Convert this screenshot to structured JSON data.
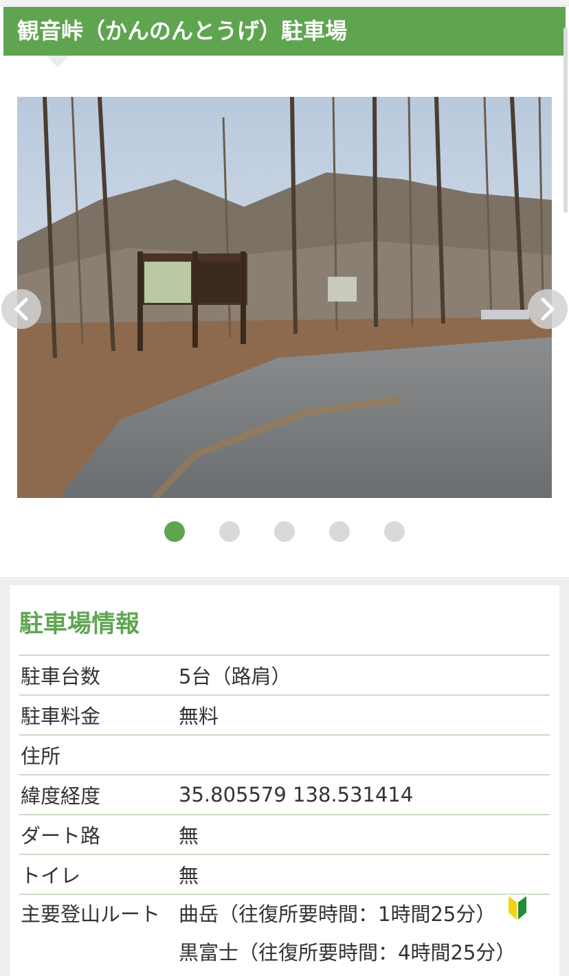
{
  "header": {
    "title": "観音峠（かんのんとうげ）駐車場"
  },
  "gallery": {
    "prev_icon": "chevron-left-icon",
    "next_icon": "chevron-right-icon",
    "slide_count": 5,
    "active_index": 0
  },
  "info": {
    "title": "駐車場情報",
    "rows": [
      {
        "label": "駐車台数",
        "value": "5台（路肩）"
      },
      {
        "label": "駐車料金",
        "value": "無料"
      },
      {
        "label": "住所",
        "value": ""
      },
      {
        "label": "緯度経度",
        "value": "35.805579  138.531414"
      },
      {
        "label": "ダート路",
        "value": "無"
      },
      {
        "label": "トイレ",
        "value": "無"
      }
    ],
    "routes_label": "主要登山ルート",
    "routes": [
      "曲岳（往復所要時間：1時間25分）",
      "黒富士（往復所要時間：4時間25分）"
    ],
    "beginner_icon": "beginner-mark-icon"
  },
  "colors": {
    "accent": "#5fa550",
    "divider": "#c9dcc4",
    "dot_inactive": "#d9d9d9"
  }
}
